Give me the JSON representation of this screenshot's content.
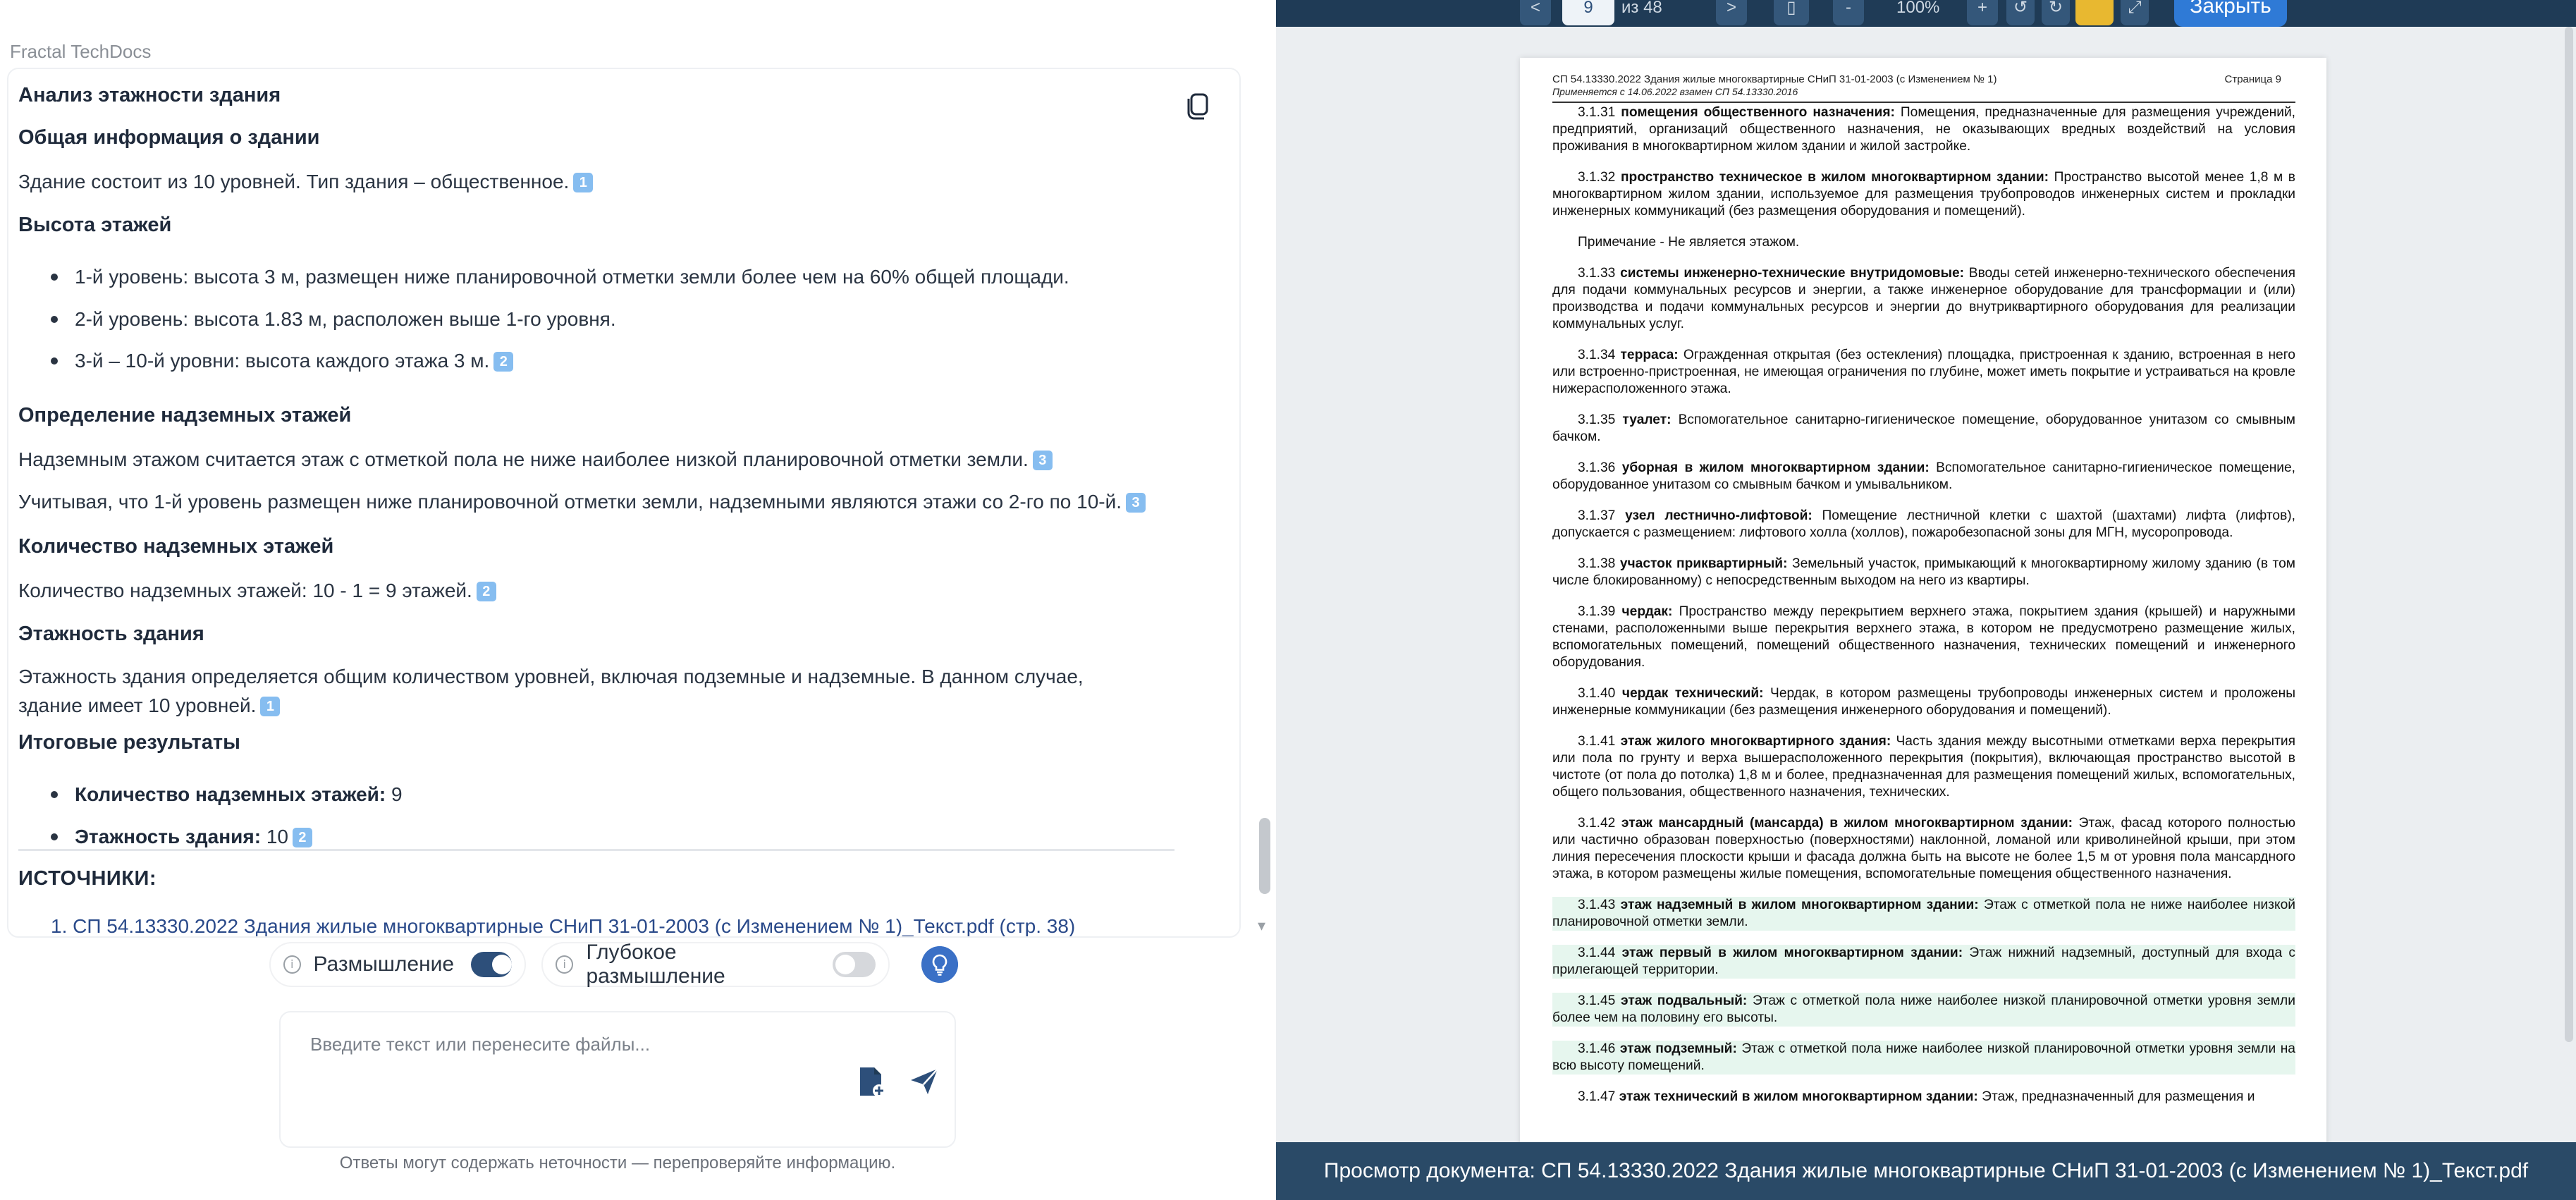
{
  "app": {
    "title": "Fractal TechDocs"
  },
  "answer": {
    "heading": "Анализ этажности здания",
    "sections": [
      {
        "title": "Общая информация о здании",
        "text": "Здание состоит из 10 уровней. Тип здания – общественное.",
        "ref": "1"
      },
      {
        "title": "Высота этажей",
        "bullets": [
          {
            "text": "1-й уровень: высота 3 м, размещен ниже планировочной отметки земли более чем на 60% общей площади."
          },
          {
            "text": "2-й уровень: высота 1.83 м, расположен выше 1-го уровня."
          },
          {
            "text": "3-й – 10-й уровни: высота каждого этажа 3 м.",
            "ref": "2"
          }
        ]
      },
      {
        "title": "Определение надземных этажей",
        "p1": "Надземным этажом считается этаж с отметкой пола не ниже наиболее низкой планировочной отметки земли.",
        "p1_ref": "3",
        "p2": "Учитывая, что 1-й уровень размещен ниже планировочной отметки земли, надземными являются этажи со 2-го по 10-й.",
        "p2_ref": "3"
      },
      {
        "title": "Количество надземных этажей",
        "text": "Количество надземных этажей: 10 - 1 = 9 этажей.",
        "ref": "2"
      },
      {
        "title": "Этажность здания",
        "text": "Этажность здания определяется общим количеством уровней, включая подземные и надземные. В данном случае, здание имеет 10 уровней.",
        "ref": "1"
      },
      {
        "title": "Итоговые результаты",
        "results": [
          {
            "label": "Количество надземных этажей:",
            "value": "9"
          },
          {
            "label": "Этажность здания:",
            "value": "10",
            "ref": "2"
          }
        ]
      }
    ],
    "sources_title": "ИСТОЧНИКИ:",
    "sources": [
      "1. СП 54.13330.2022 Здания жилые многоквартирные СНиП 31-01-2003 (с Изменением № 1)_Текст.pdf (стр. 38)"
    ]
  },
  "controls": {
    "thinking_label": "Размышление",
    "thinking_on": true,
    "deep_thinking_label": "Глубокое размышление",
    "deep_thinking_on": false,
    "input_placeholder": "Введите текст или перенесите файлы...",
    "disclaimer": "Ответы могут содержать неточности — перепроверяйте информацию."
  },
  "viewer": {
    "toolbar": {
      "prev": "<",
      "page": "9",
      "of_total": "из 48",
      "next": ">",
      "zoom_out": "-",
      "zoom": "100%",
      "zoom_in": "+",
      "close_label": "Закрыть"
    },
    "doc_header_line1": "СП 54.13330.2022 Здания жилые многоквартирные СНиП 31-01-2003 (с Изменением № 1)",
    "doc_header_line2": "Применяется с 14.06.2022 взамен СП 54.13330.2016",
    "doc_page_label": "Страница 9",
    "paragraphs": [
      {
        "num": "3.1.31",
        "term": "помещения общественного назначения:",
        "text": "Помещения, предназначенные для размещения учреждений, предприятий, организаций общественного назначения, не оказывающих вредных воздействий на условия проживания в многоквартирном жилом здании и жилой застройке.",
        "highlight": false
      },
      {
        "num": "3.1.32",
        "term": "пространство техническое в жилом многоквартирном здании:",
        "text": "Пространство высотой менее 1,8 м в многоквартирном жилом здании, используемое для размещения трубопроводов инженерных систем и прокладки инженерных коммуникаций (без размещения оборудования и помещений).",
        "highlight": false
      },
      {
        "num": "",
        "term": "",
        "text": "Примечание - Не является этажом.",
        "highlight": false
      },
      {
        "num": "3.1.33",
        "term": "системы инженерно-технические внутридомовые:",
        "text": "Вводы сетей инженерно-технического обеспечения для подачи коммунальных ресурсов и энергии, а также инженерное оборудование для трансформации и (или) производства и подачи коммунальных ресурсов и энергии до внутриквартирного оборудования для реализации коммунальных услуг.",
        "highlight": false
      },
      {
        "num": "3.1.34",
        "term": "терраса:",
        "text": "Огражденная открытая (без остекления) площадка, пристроенная к зданию, встроенная в него или встроенно-пристроенная, не имеющая ограничения по глубине, может иметь покрытие и устраиваться на кровле нижерасположенного этажа.",
        "highlight": false
      },
      {
        "num": "3.1.35",
        "term": "туалет:",
        "text": "Вспомогательное санитарно-гигиеническое помещение, оборудованное унитазом со смывным бачком.",
        "highlight": false
      },
      {
        "num": "3.1.36",
        "term": "уборная в жилом многоквартирном здании:",
        "text": "Вспомогательное санитарно-гигиеническое помещение, оборудованное унитазом со смывным бачком и умывальником.",
        "highlight": false
      },
      {
        "num": "3.1.37",
        "term": "узел лестнично-лифтовой:",
        "text": "Помещение лестничной клетки с шахтой (шахтами) лифта (лифтов), допускается с размещением: лифтового холла (холлов), пожаробезопасной зоны для МГН, мусоропровода.",
        "highlight": false
      },
      {
        "num": "3.1.38",
        "term": "участок приквартирный:",
        "text": "Земельный участок, примыкающий к многоквартирному жилому зданию (в том числе блокированному) с непосредственным выходом на него из квартиры.",
        "highlight": false
      },
      {
        "num": "3.1.39",
        "term": "чердак:",
        "text": "Пространство между перекрытием верхнего этажа, покрытием здания (крышей) и наружными стенами, расположенными выше перекрытия верхнего этажа, в котором не предусмотрено размещение жилых, вспомогательных помещений, помещений общественного назначения, технических помещений и инженерного оборудования.",
        "highlight": false
      },
      {
        "num": "3.1.40",
        "term": "чердак технический:",
        "text": "Чердак, в котором размещены трубопроводы инженерных систем и проложены инженерные коммуникации (без размещения инженерного оборудования и помещений).",
        "highlight": false
      },
      {
        "num": "3.1.41",
        "term": "этаж жилого многоквартирного здания:",
        "text": "Часть здания между высотными отметками верха перекрытия или пола по грунту и верха вышерасположенного перекрытия (покрытия), включающая пространство высотой в чистоте (от пола до потолка) 1,8 м и более, предназначенная для размещения помещений жилых, вспомогательных, общего пользования, общественного назначения, технических.",
        "highlight": false
      },
      {
        "num": "3.1.42",
        "term": "этаж мансардный (мансарда) в жилом многоквартирном здании:",
        "text": "Этаж, фасад которого полностью или частично образован поверхностью (поверхностями) наклонной, ломаной или криволинейной крыши, при этом линия пересечения плоскости крыши и фасада должна быть на высоте не более 1,5 м от уровня пола мансардного этажа, в котором размещены жилые помещения, вспомогательные помещения общественного назначения.",
        "highlight": false
      },
      {
        "num": "3.1.43",
        "term": "этаж надземный в жилом многоквартирном здании:",
        "text": "Этаж с отметкой пола не ниже наиболее низкой планировочной отметки земли.",
        "highlight": true
      },
      {
        "num": "3.1.44",
        "term": "этаж первый в жилом многоквартирном здании:",
        "text": "Этаж нижний надземный, доступный для входа с прилегающей территории.",
        "highlight": true
      },
      {
        "num": "3.1.45",
        "term": "этаж подвальный:",
        "text": "Этаж с отметкой пола ниже наиболее низкой планировочной отметки уровня земли более чем на половину его высоты.",
        "highlight": true
      },
      {
        "num": "3.1.46",
        "term": "этаж подземный:",
        "text": "Этаж с отметкой пола ниже наиболее низкой планировочной отметки уровня земли на всю высоту помещений.",
        "highlight": true
      },
      {
        "num": "3.1.47",
        "term": "этаж технический в жилом многоквартирном здании:",
        "text": "Этаж, предназначенный для размещения и",
        "highlight": false
      }
    ],
    "footer": "Просмотр документа: СП 54.13330.2022 Здания жилые многоквартирные СНиП 31-01-2003 (с Изменением № 1)_Текст.pdf"
  },
  "colors": {
    "accent": "#2d4f7a",
    "ref_badge": "#86bdf0",
    "viewer_bg": "#2a4a67",
    "close_button": "#2f7ad6",
    "doc_highlight": "#e6f6ee"
  },
  "icons": {
    "copy": "copy-icon",
    "info": "info-icon",
    "bulb": "lightbulb-icon",
    "attach": "attach-file-icon",
    "send": "send-icon",
    "highlight_tool": "highlighter-icon",
    "print": "print-icon"
  }
}
